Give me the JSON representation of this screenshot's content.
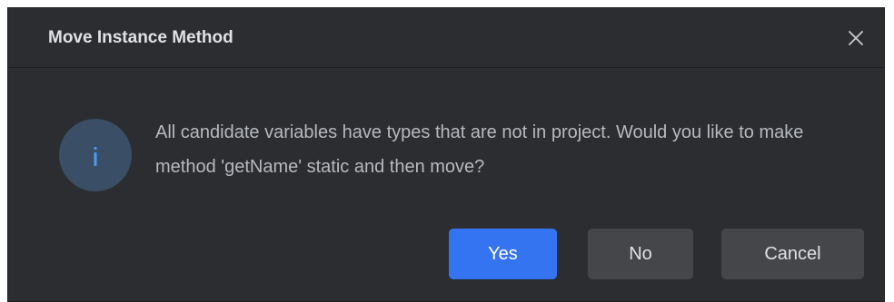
{
  "dialog": {
    "title": "Move Instance Method",
    "close_icon": "close-icon",
    "info_icon": "info-icon",
    "message": "All candidate variables have types that are not in project. Would you like to make method 'getName' static and then move?",
    "buttons": {
      "yes": "Yes",
      "no": "No",
      "cancel": "Cancel"
    }
  },
  "colors": {
    "background": "#2b2d30",
    "accent": "#3574f0",
    "secondary_button": "#44464a",
    "icon_circle": "#3a4e66",
    "icon_glyph": "#4b9cf5",
    "text": "#b6b9bf",
    "title_text": "#dfe1e5"
  }
}
